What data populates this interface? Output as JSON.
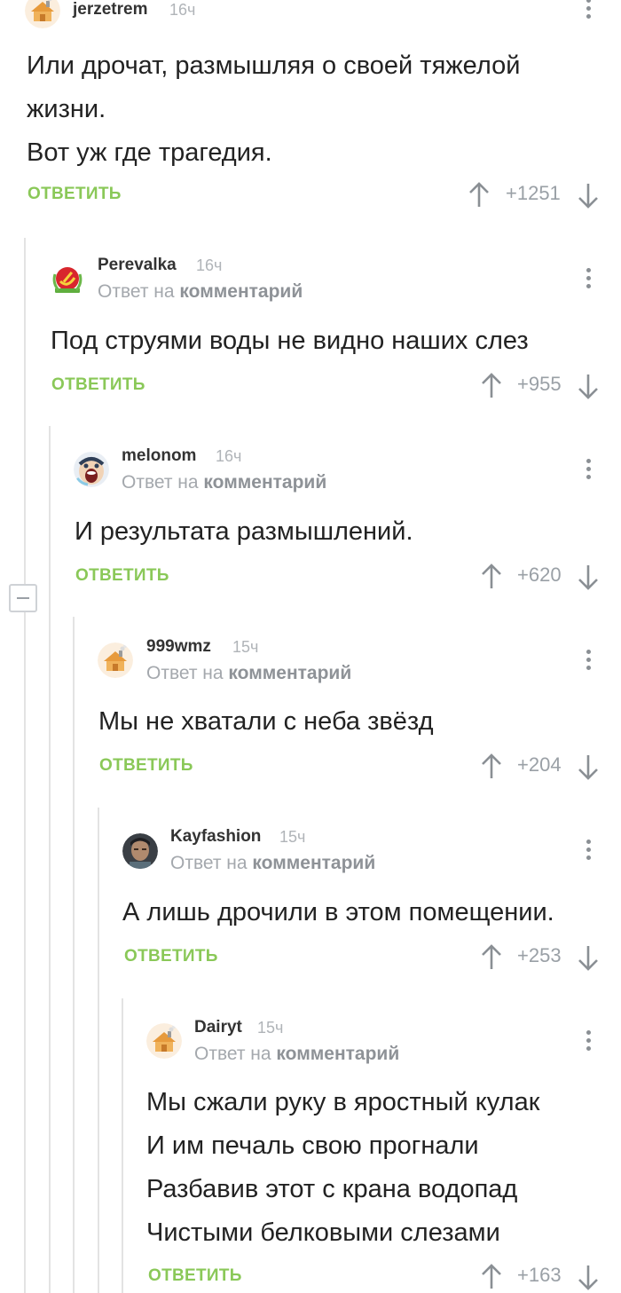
{
  "comments": [
    {
      "username": "jerzetrem",
      "time": "16ч",
      "lines": [
        "Или дрочат, размышляя о своей тяжелой",
        "жизни.",
        "Вот уж где трагедия."
      ],
      "reply_label": "ОТВЕТИТЬ",
      "score": "+1251",
      "avatar": "house-avatar"
    },
    {
      "username": "Perevalka",
      "time": "16ч",
      "reply_prefix": "Ответ на ",
      "reply_target": "комментарий",
      "lines": [
        "Под струями воды не видно наших слез"
      ],
      "reply_label": "ОТВЕТИТЬ",
      "score": "+955",
      "avatar": "soviet-emblem-avatar"
    },
    {
      "username": "melonom",
      "time": "16ч",
      "reply_prefix": "Ответ на ",
      "reply_target": "комментарий",
      "lines": [
        "И результата размышлений."
      ],
      "reply_label": "ОТВЕТИТЬ",
      "score": "+620",
      "avatar": "screaming-face-avatar"
    },
    {
      "username": "999wmz",
      "time": "15ч",
      "reply_prefix": "Ответ на ",
      "reply_target": "комментарий",
      "lines": [
        "Мы не хватали с неба звёзд"
      ],
      "reply_label": "ОТВЕТИТЬ",
      "score": "+204",
      "avatar": "house-avatar"
    },
    {
      "username": "Kayfashion",
      "time": "15ч",
      "reply_prefix": "Ответ на ",
      "reply_target": "комментарий",
      "lines": [
        "А лишь дрочили в этом помещении."
      ],
      "reply_label": "ОТВЕТИТЬ",
      "score": "+253",
      "avatar": "person-photo-avatar"
    },
    {
      "username": "Dairyt",
      "time": "15ч",
      "reply_prefix": "Ответ на ",
      "reply_target": "комментарий",
      "lines": [
        "Мы сжали руку в яростный кулак",
        "И им печаль свою прогнали",
        "Разбавив этот с крана водопад",
        "Чистыми белковыми слезами"
      ],
      "reply_label": "ОТВЕТИТЬ",
      "score": "+163",
      "avatar": "house-avatar"
    }
  ],
  "icons": {
    "vote_up": "arrow-up-icon",
    "vote_down": "arrow-down-icon",
    "menu": "more-vertical-icon",
    "collapse": "collapse-thread-icon"
  },
  "colors": {
    "accent_green": "#8ac858",
    "text": "#222222",
    "muted": "#a4a8ad",
    "thread_line": "#e3e3e3"
  }
}
